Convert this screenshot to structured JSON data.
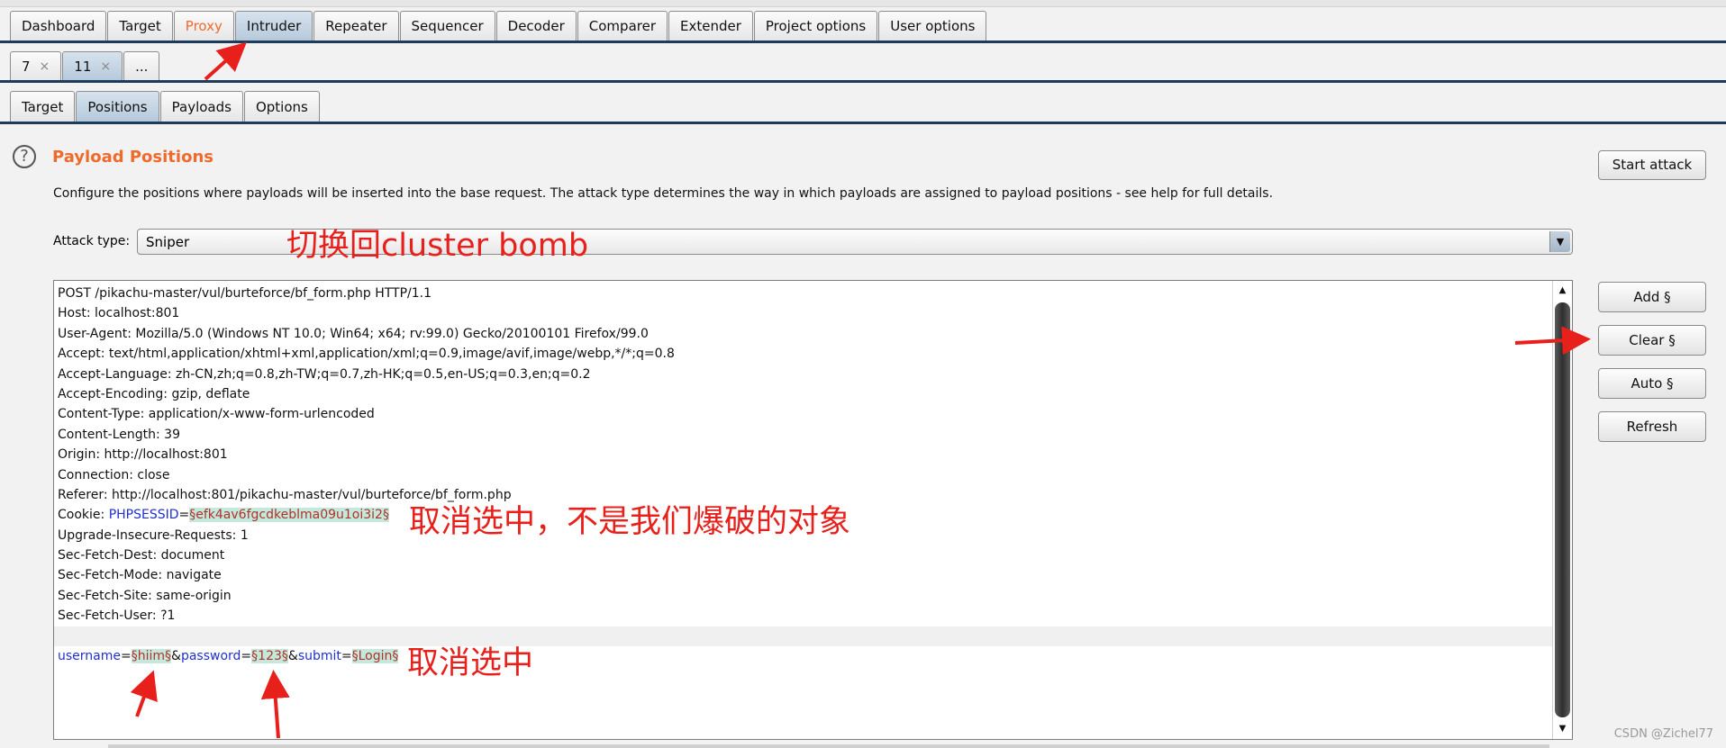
{
  "main_tabs": [
    "Dashboard",
    "Target",
    "Proxy",
    "Intruder",
    "Repeater",
    "Sequencer",
    "Decoder",
    "Comparer",
    "Extender",
    "Project options",
    "User options"
  ],
  "main_tabs_active": "Intruder",
  "proxy_color": "#ee6b2c",
  "session_tabs": [
    {
      "label": "7",
      "close": "×"
    },
    {
      "label": "11",
      "close": "×"
    },
    {
      "label": "..."
    }
  ],
  "sub_tabs": [
    "Target",
    "Positions",
    "Payloads",
    "Options"
  ],
  "section": {
    "help_icon": "?",
    "title": "Payload Positions",
    "description": "Configure the positions where payloads will be inserted into the base request. The attack type determines the way in which payloads are assigned to payload positions - see help for full details."
  },
  "attack": {
    "label": "Attack type:",
    "value": "Sniper"
  },
  "buttons": {
    "start": "Start attack",
    "add": "Add §",
    "clear": "Clear §",
    "auto": "Auto §",
    "refresh": "Refresh"
  },
  "request": {
    "l1": "POST /pikachu-master/vul/burteforce/bf_form.php HTTP/1.1",
    "l2": "Host: localhost:801",
    "l3": "User-Agent: Mozilla/5.0 (Windows NT 10.0; Win64; x64; rv:99.0) Gecko/20100101 Firefox/99.0",
    "l4": "Accept: text/html,application/xhtml+xml,application/xml;q=0.9,image/avif,image/webp,*/*;q=0.8",
    "l5": "Accept-Language: zh-CN,zh;q=0.8,zh-TW;q=0.7,zh-HK;q=0.5,en-US;q=0.3,en;q=0.2",
    "l6": "Accept-Encoding: gzip, deflate",
    "l7": "Content-Type: application/x-www-form-urlencoded",
    "l8": "Content-Length: 39",
    "l9": "Origin: http://localhost:801",
    "l10": "Connection: close",
    "l11": "Referer: http://localhost:801/pikachu-master/vul/burteforce/bf_form.php",
    "cookie_prefix": "Cookie: ",
    "cookie_name": "PHPSESSID",
    "eq": "=",
    "cookie_value": "§efk4av6fgcdkeblma09u1oi3i2§",
    "l13": "Upgrade-Insecure-Requests: 1",
    "l14": "Sec-Fetch-Dest: document",
    "l15": "Sec-Fetch-Mode: navigate",
    "l16": "Sec-Fetch-Site: same-origin",
    "l17": "Sec-Fetch-User: ?1",
    "body": {
      "p1": "username",
      "v1": "§hiim§",
      "amp1": "&",
      "p2": "password",
      "v2": "§123§",
      "amp2": "&",
      "p3": "submit",
      "v3": "§Login§"
    }
  },
  "annotations": {
    "cluster": "切换回cluster bomb",
    "cookie": "取消选中，不是我们爆破的对象",
    "body": "取消选中"
  },
  "annotation_color": "#e8201c",
  "watermark": "CSDN @Zichel77"
}
